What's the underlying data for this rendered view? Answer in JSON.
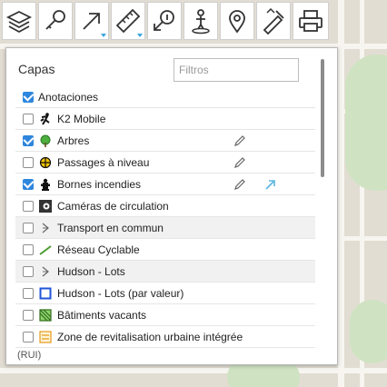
{
  "toolbar": {
    "tools": [
      {
        "icon": "layers-icon"
      },
      {
        "icon": "search-key-icon"
      },
      {
        "icon": "arrow-up-right-icon",
        "menu": true
      },
      {
        "icon": "ruler-icon",
        "menu": true
      },
      {
        "icon": "route-info-icon"
      },
      {
        "icon": "pedestrian-icon"
      },
      {
        "icon": "location-pin-icon"
      },
      {
        "icon": "edit-tool-icon"
      },
      {
        "icon": "print-icon"
      }
    ]
  },
  "layers_panel": {
    "title": "Capas",
    "filter": {
      "placeholder": "Filtros",
      "value": ""
    },
    "items": [
      {
        "label": "Anotaciones",
        "checked": true,
        "icon": "none"
      },
      {
        "label": "K2 Mobile",
        "checked": false,
        "icon": "runner-icon"
      },
      {
        "label": "Arbres",
        "checked": true,
        "icon": "tree-icon",
        "edit": true
      },
      {
        "label": "Passages à niveau",
        "checked": false,
        "icon": "crosshair-icon",
        "edit": true
      },
      {
        "label": "Bornes incendies",
        "checked": true,
        "icon": "hydrant-icon",
        "edit": true,
        "zoom": true
      },
      {
        "label": "Caméras de circulation",
        "checked": false,
        "icon": "camera-icon"
      },
      {
        "label": "Transport en commun",
        "checked": false,
        "icon": "arrow-symbol-icon"
      },
      {
        "label": "Réseau Cyclable",
        "checked": false,
        "icon": "green-line-icon"
      },
      {
        "label": "Hudson - Lots",
        "checked": false,
        "icon": "arrow-symbol-icon"
      },
      {
        "label": "Hudson - Lots (par valeur)",
        "checked": false,
        "icon": "blue-square-icon"
      },
      {
        "label": "Bâtiments vacants",
        "checked": false,
        "icon": "green-hatch-icon"
      },
      {
        "label": "Zone de revitalisation urbaine intégrée",
        "checked": false,
        "icon": "orange-hatch-icon"
      }
    ],
    "overflow_text": "(RUI)"
  },
  "colors": {
    "accent": "#2f86dd",
    "caret": "#3aa6dd",
    "panel_border": "#b9b9b9"
  }
}
